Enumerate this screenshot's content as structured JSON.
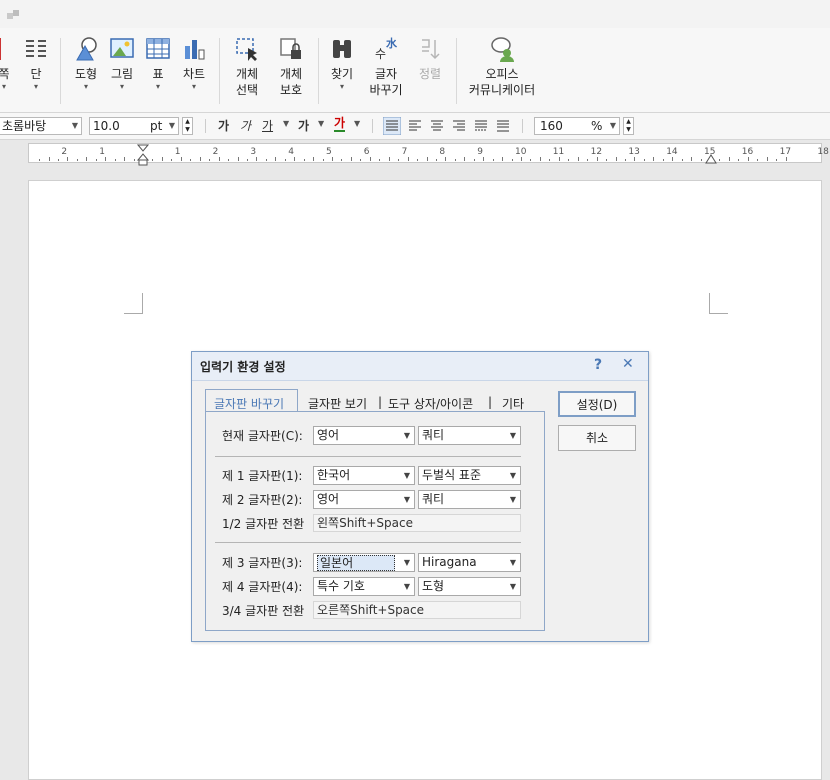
{
  "ribbon": {
    "items": [
      {
        "label": "쪽",
        "caret": "▾"
      },
      {
        "label": "단",
        "caret": "▾"
      },
      {
        "label": "도형",
        "caret": "▾"
      },
      {
        "label": "그림",
        "caret": "▾"
      },
      {
        "label": "표",
        "caret": "▾"
      },
      {
        "label": "차트",
        "caret": "▾"
      },
      {
        "label": "개체\n선택",
        "caret": "▾"
      },
      {
        "label": "개체\n보호",
        "caret": "▾"
      },
      {
        "label": "찾기",
        "caret": "▾"
      },
      {
        "label": "글자\n바꾸기",
        "caret": "▾"
      },
      {
        "label": "정렬"
      },
      {
        "label": "오피스\n커뮤니케이터"
      }
    ],
    "glyph_replace": "水",
    "glyph_replace_small": "수"
  },
  "format_bar": {
    "font": "초롬바탕",
    "size": "10.0",
    "unit": "pt",
    "bold": "가",
    "italic": "가",
    "underline": "가",
    "strike": "가",
    "color_text": "가",
    "zoom": "160",
    "zoom_unit": "%"
  },
  "ruler": {
    "labels": [
      "2",
      "1",
      "1",
      "2",
      "3",
      "4",
      "5",
      "6",
      "7",
      "8",
      "9",
      "10",
      "11",
      "12",
      "13",
      "14",
      "15",
      "16",
      "17",
      "18"
    ]
  },
  "dialog": {
    "title": "입력기 환경 설정",
    "help": "?",
    "close": "✕",
    "tabs": [
      "글자판 바꾸기",
      "글자판 보기",
      "도구 상자/아이콘",
      "기타"
    ],
    "tab_separator": "|",
    "current_label": "현재 글자판(C):",
    "current_lang": "영어",
    "current_layout": "쿼티",
    "kb1_label": "제 1 글자판(1):",
    "kb1_lang": "한국어",
    "kb1_layout": "두벌식 표준",
    "kb2_label": "제 2 글자판(2):",
    "kb2_lang": "영어",
    "kb2_layout": "쿼티",
    "switch12_label": "1/2 글자판 전환",
    "switch12_value": "왼쪽Shift+Space",
    "kb3_label": "제 3 글자판(3):",
    "kb3_lang": "일본어",
    "kb3_layout": "Hiragana",
    "kb4_label": "제 4 글자판(4):",
    "kb4_lang": "특수 기호",
    "kb4_layout": "도형",
    "switch34_label": "3/4 글자판 전환",
    "switch34_value": "오른쪽Shift+Space",
    "ok": "설정(D)",
    "cancel": "취소"
  }
}
